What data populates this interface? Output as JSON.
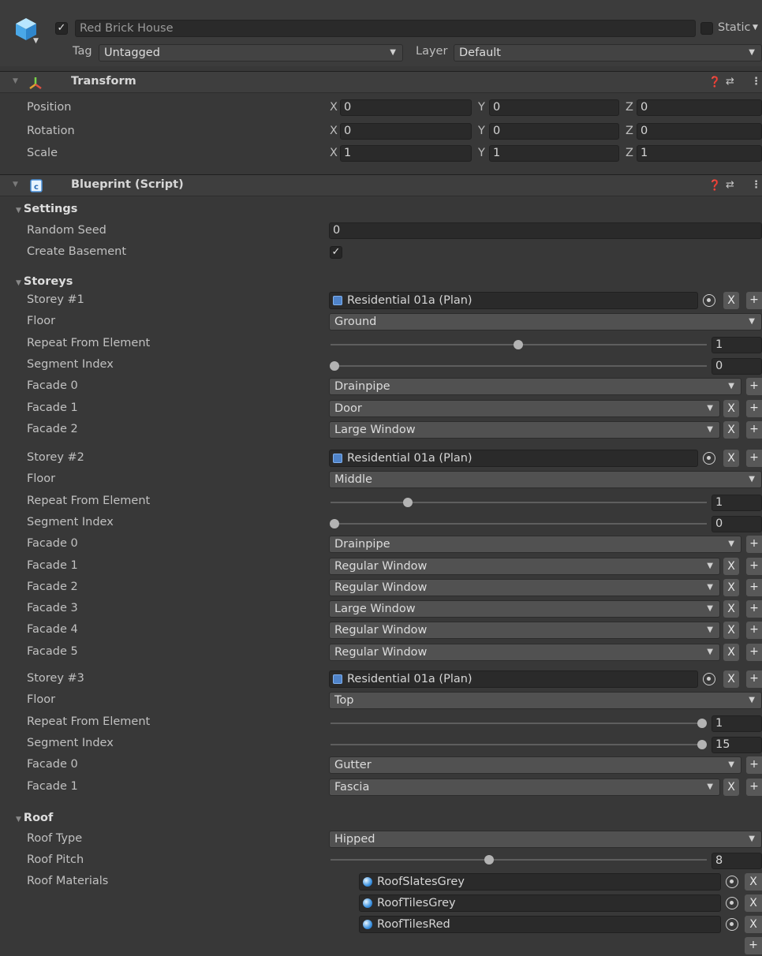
{
  "gameobject": {
    "active": true,
    "name": "Red Brick House",
    "static_label": "Static",
    "tag_label": "Tag",
    "tag_value": "Untagged",
    "layer_label": "Layer",
    "layer_value": "Default"
  },
  "transform": {
    "title": "Transform",
    "rows": [
      {
        "label": "Position",
        "x": "0",
        "y": "0",
        "z": "0"
      },
      {
        "label": "Rotation",
        "x": "0",
        "y": "0",
        "z": "0"
      },
      {
        "label": "Scale",
        "x": "1",
        "y": "1",
        "z": "1"
      }
    ],
    "axes": [
      "X",
      "Y",
      "Z"
    ]
  },
  "blueprint": {
    "title": "Blueprint (Script)",
    "settings": {
      "title": "Settings",
      "random_seed_label": "Random Seed",
      "random_seed": "0",
      "create_basement_label": "Create Basement",
      "create_basement": true
    },
    "storeys": {
      "title": "Storeys",
      "list": [
        {
          "label": "Storey #1",
          "plan": "Residential 01a (Plan)",
          "floor_label": "Floor",
          "floor": "Ground",
          "repeat_label": "Repeat From Element",
          "repeat": "1",
          "repeat_frac": 0.5,
          "segment_label": "Segment Index",
          "segment": "0",
          "segment_frac": 0.0,
          "facades": [
            {
              "label": "Facade 0",
              "value": "Drainpipe"
            },
            {
              "label": "Facade 1",
              "value": "Door"
            },
            {
              "label": "Facade 2",
              "value": "Large Window"
            }
          ]
        },
        {
          "label": "Storey #2",
          "plan": "Residential 01a (Plan)",
          "floor_label": "Floor",
          "floor": "Middle",
          "repeat_label": "Repeat From Element",
          "repeat": "1",
          "repeat_frac": 0.2,
          "segment_label": "Segment Index",
          "segment": "0",
          "segment_frac": 0.0,
          "facades": [
            {
              "label": "Facade 0",
              "value": "Drainpipe"
            },
            {
              "label": "Facade 1",
              "value": "Regular Window"
            },
            {
              "label": "Facade 2",
              "value": "Regular Window"
            },
            {
              "label": "Facade 3",
              "value": "Large Window"
            },
            {
              "label": "Facade 4",
              "value": "Regular Window"
            },
            {
              "label": "Facade 5",
              "value": "Regular Window"
            }
          ]
        },
        {
          "label": "Storey #3",
          "plan": "Residential 01a (Plan)",
          "floor_label": "Floor",
          "floor": "Top",
          "repeat_label": "Repeat From Element",
          "repeat": "1",
          "repeat_frac": 1.0,
          "segment_label": "Segment Index",
          "segment": "15",
          "segment_frac": 1.0,
          "facades": [
            {
              "label": "Facade 0",
              "value": "Gutter"
            },
            {
              "label": "Facade 1",
              "value": "Fascia"
            }
          ]
        }
      ]
    },
    "roof": {
      "title": "Roof",
      "type_label": "Roof Type",
      "type": "Hipped",
      "pitch_label": "Roof Pitch",
      "pitch": "8",
      "pitch_frac": 0.42,
      "materials_label": "Roof Materials",
      "materials": [
        "RoofSlatesGrey",
        "RoofTilesGrey",
        "RoofTilesRed"
      ]
    }
  },
  "buttons": {
    "remove": "X",
    "add": "+"
  },
  "icons": {
    "gameobject": "cube-icon",
    "transform": "transform-axes-icon",
    "script": "csharp-script-icon",
    "help": "help-icon",
    "presets": "presets-icon",
    "menu": "kebab-menu-icon"
  }
}
